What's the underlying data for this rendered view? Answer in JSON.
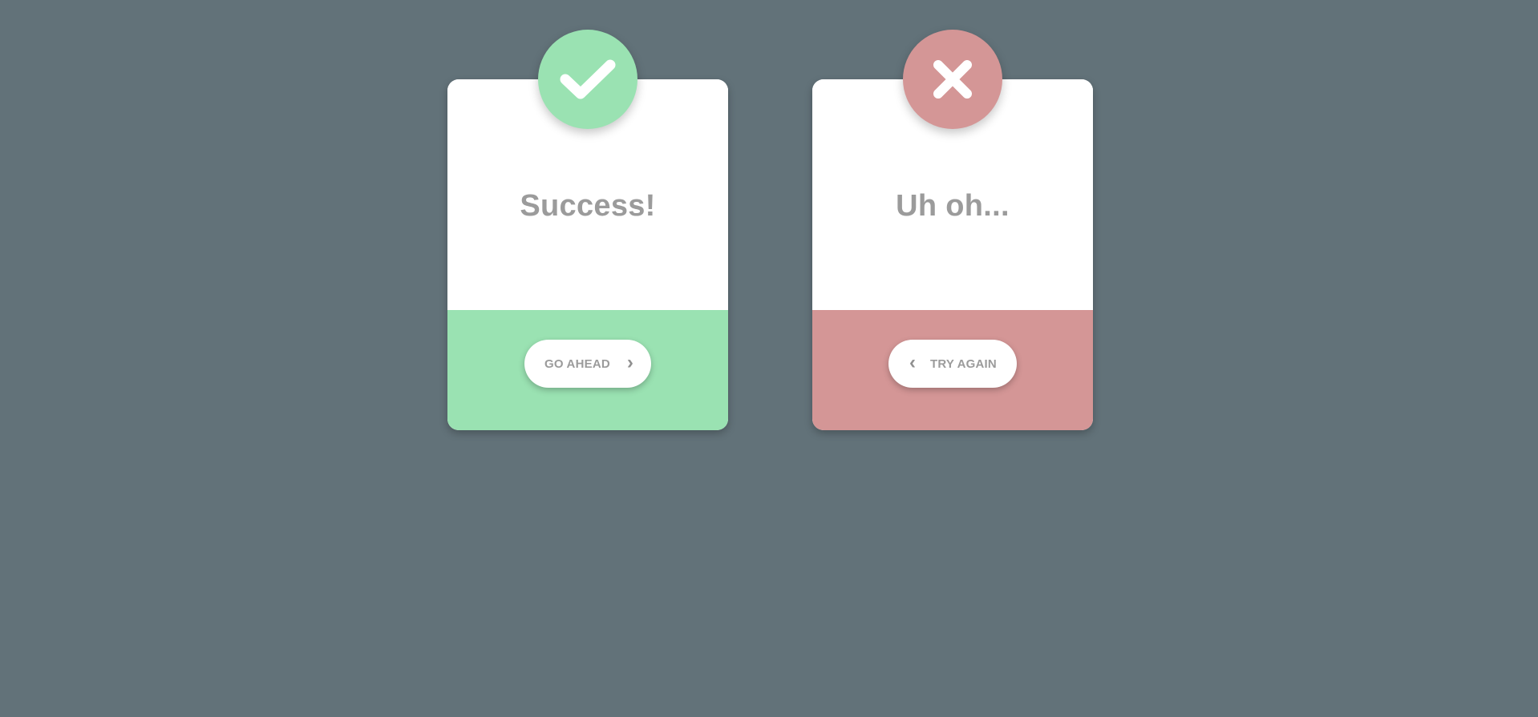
{
  "colors": {
    "background": "#627279",
    "success_accent": "#9ae2b2",
    "error_accent": "#d49696",
    "card_surface": "#ffffff",
    "text_muted": "#9b9b9b"
  },
  "success_card": {
    "icon": "check-icon",
    "title": "Success!",
    "button": {
      "label": "GO AHEAD",
      "arrow": "›"
    }
  },
  "error_card": {
    "icon": "close-icon",
    "title": "Uh oh...",
    "button": {
      "label": "TRY AGAIN",
      "arrow": "‹"
    }
  }
}
